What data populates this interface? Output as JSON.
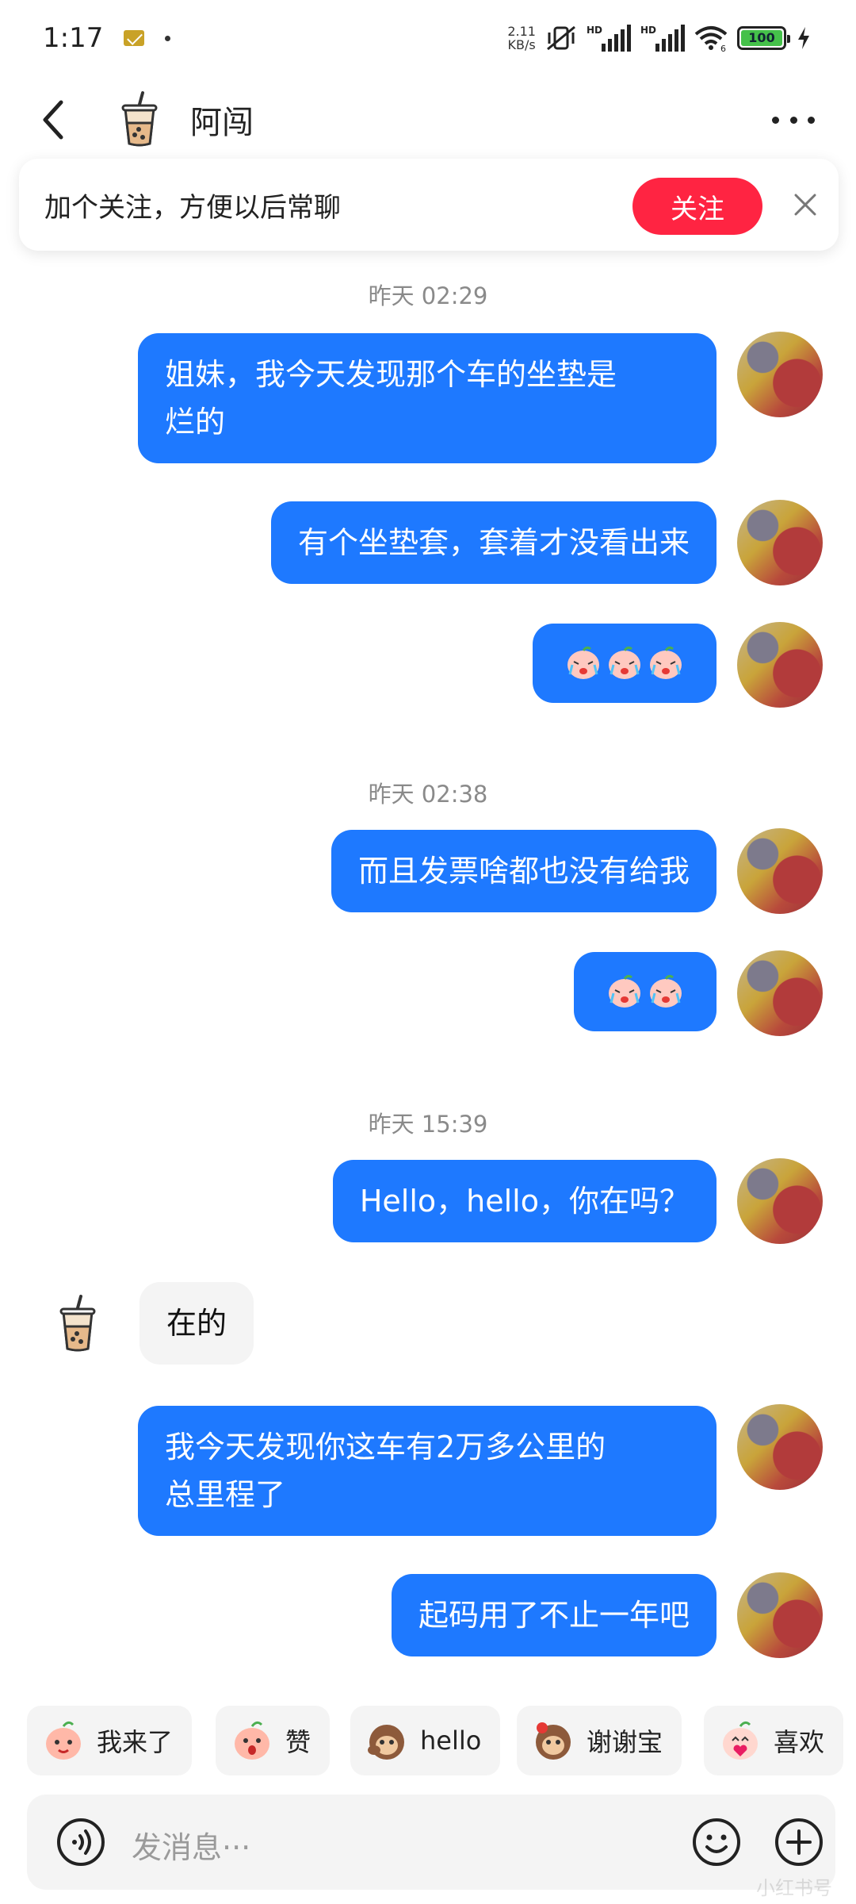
{
  "status_bar": {
    "time": "1:17",
    "net_speed_value": "2.11",
    "net_speed_unit": "KB/s",
    "hd1": "HD",
    "hd2": "HD",
    "wifi_label": "6",
    "battery": "100"
  },
  "header": {
    "name": "阿闯",
    "more_label": "more-options"
  },
  "follow_banner": {
    "text": "加个关注，方便以后常聊",
    "button_label": "关注"
  },
  "messages": {
    "ts1": "昨天 02:29",
    "m1": [
      "姐妹，我今天发现那个车的坐垫是",
      "烂的"
    ],
    "m2": "有个坐垫套，套着才没看出来",
    "ts2": "昨天 02:38",
    "m4": "而且发票啥都也没有给我",
    "ts3": "昨天 15:39",
    "m6": "Hello，hello，你在吗？",
    "in1": "在的",
    "m7": [
      "我今天发现你这车有2万多公里的",
      "总里程了"
    ],
    "m8": "起码用了不止一年吧"
  },
  "quick_replies": [
    "我来了",
    "赞",
    "hello",
    "谢谢宝",
    "喜欢"
  ],
  "input": {
    "placeholder": "发消息···"
  },
  "watermark": "小红书号",
  "colors": {
    "bubble_out": "#1e79ff",
    "follow_button": "#ff2442",
    "bubble_in": "#f4f4f4"
  }
}
